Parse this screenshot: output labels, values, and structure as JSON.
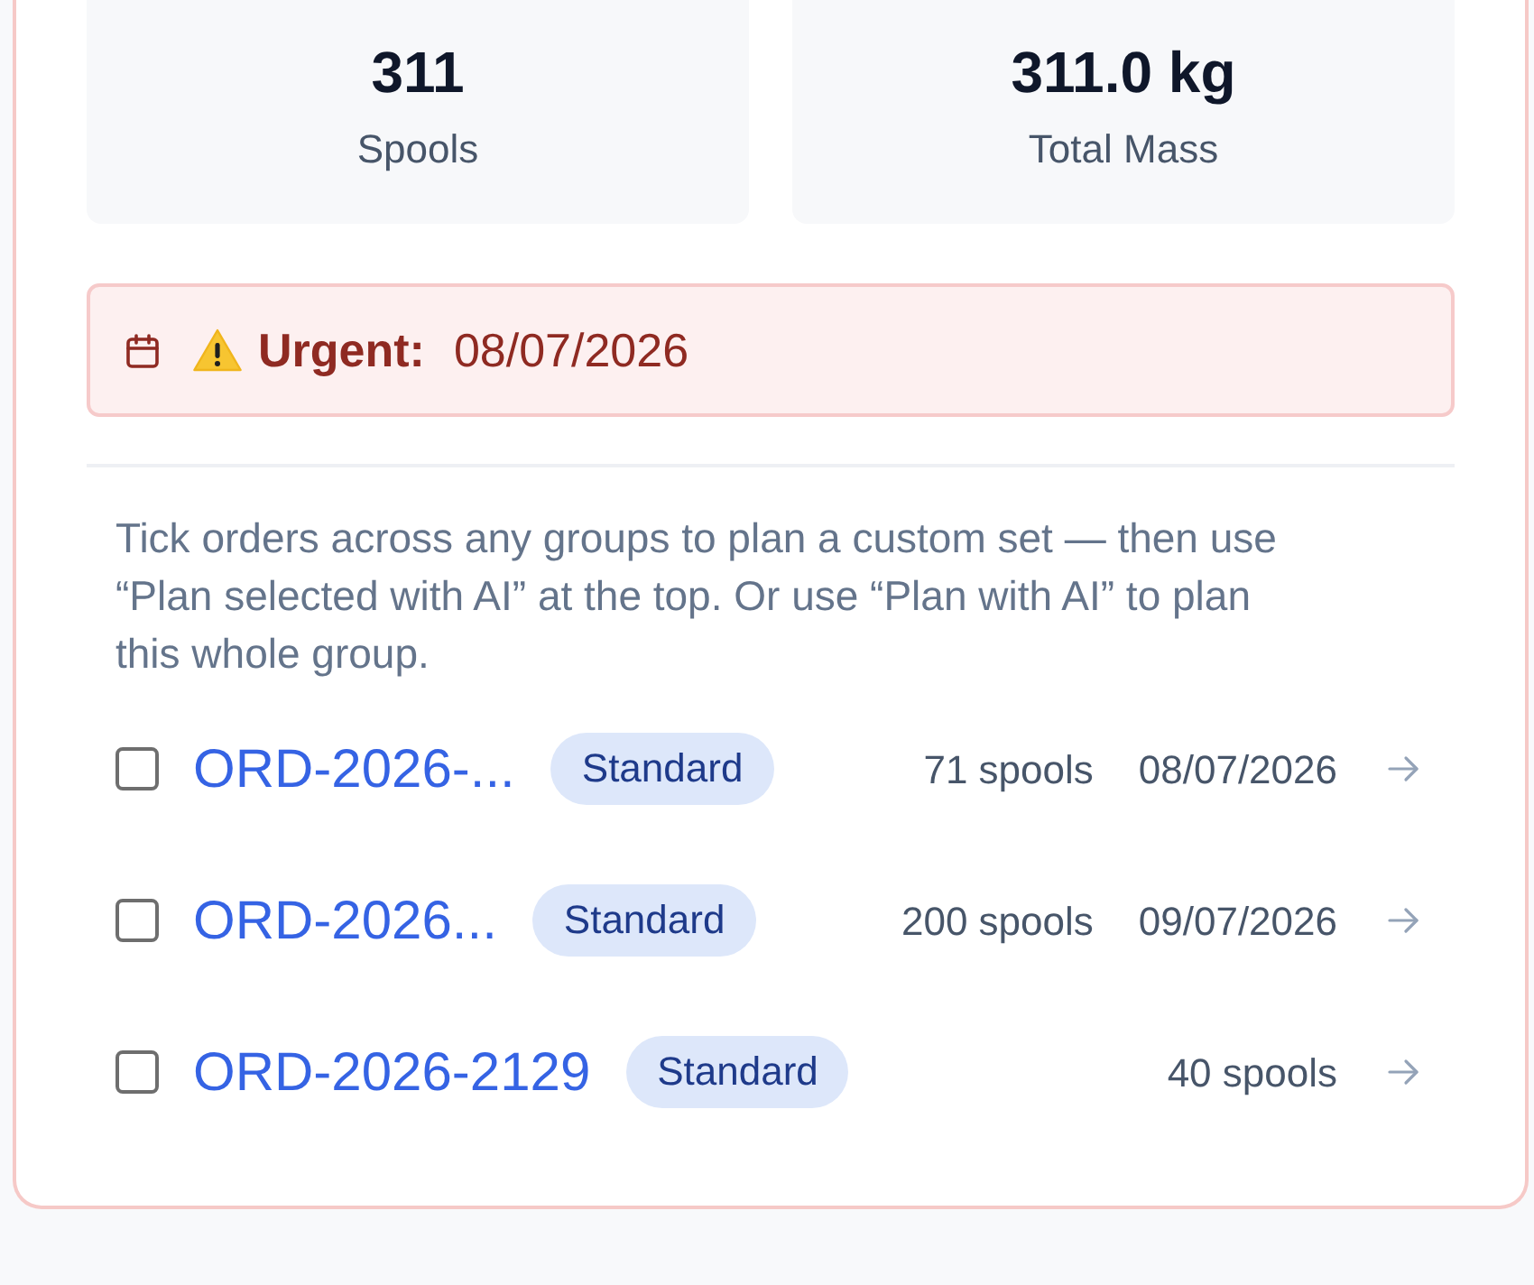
{
  "stats": [
    {
      "value": "311",
      "label": "Spools"
    },
    {
      "value": "311.0 kg",
      "label": "Total Mass"
    }
  ],
  "alert": {
    "label": "Urgent:",
    "date": "08/07/2026"
  },
  "hint": "Tick orders across any groups to plan a custom set — then use “Plan selected with AI” at the top. Or use “Plan with AI” to plan this whole group.",
  "orders": [
    {
      "id": "ORD-2026-...",
      "checked": false,
      "badge": "Standard",
      "spools": "71 spools",
      "date": "08/07/2026"
    },
    {
      "id": "ORD-2026...",
      "checked": false,
      "badge": "Standard",
      "spools": "200 spools",
      "date": "09/07/2026"
    },
    {
      "id": "ORD-2026-2129",
      "checked": false,
      "badge": "Standard",
      "spools": "40 spools"
    }
  ]
}
